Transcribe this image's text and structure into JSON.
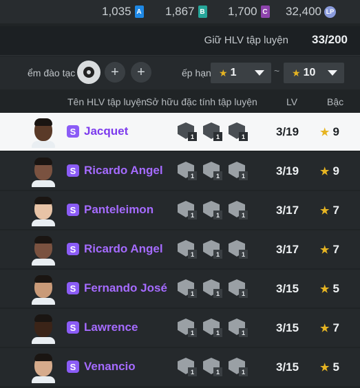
{
  "currencies": [
    {
      "amount": "1,035",
      "tag": "A",
      "color": "#1e88e5"
    },
    {
      "amount": "1,867",
      "tag": "B",
      "color": "#26a69a"
    },
    {
      "amount": "1,700",
      "tag": "C",
      "color": "#8e44ad"
    },
    {
      "amount": "32,400",
      "tag": "LP",
      "color": "#8a9bdc"
    }
  ],
  "trainer_bar": {
    "label": "Giữ HLV tập luyện",
    "count": "33/200"
  },
  "filters": {
    "trait_label": "ểm đào tạc",
    "rank_label": "ếp hạn",
    "min_rank": "1",
    "max_rank": "10",
    "tilde": "~"
  },
  "headers": {
    "name": "Tên HLV tập luyện",
    "traits": "Sở hữu đặc tính tập luyện",
    "lv": "LV",
    "grade": "Bậc"
  },
  "rows": [
    {
      "name": "Jacquet",
      "lv": "3/19",
      "grade": "9",
      "trait_counts": [
        "1",
        "1",
        "1"
      ],
      "skin": "#5a3a28"
    },
    {
      "name": "Ricardo Angel",
      "lv": "3/19",
      "grade": "9",
      "trait_counts": [
        "1",
        "1",
        "1"
      ],
      "skin": "#7a5240"
    },
    {
      "name": "Panteleimon",
      "lv": "3/17",
      "grade": "7",
      "trait_counts": [
        "1",
        "1",
        "1"
      ],
      "skin": "#e7c3a6"
    },
    {
      "name": "Ricardo Angel",
      "lv": "3/17",
      "grade": "7",
      "trait_counts": [
        "1",
        "1",
        "1"
      ],
      "skin": "#7a5240"
    },
    {
      "name": "Fernando José",
      "lv": "3/15",
      "grade": "5",
      "trait_counts": [
        "1",
        "1",
        "1"
      ],
      "skin": "#c99a78"
    },
    {
      "name": "Lawrence",
      "lv": "3/15",
      "grade": "7",
      "trait_counts": [
        "1",
        "1",
        "1"
      ],
      "skin": "#3b2418"
    },
    {
      "name": "Venancio",
      "lv": "3/15",
      "grade": "5",
      "trait_counts": [
        "1",
        "1",
        "1"
      ],
      "skin": "#d6ab8c"
    }
  ],
  "rank_badge": "S"
}
